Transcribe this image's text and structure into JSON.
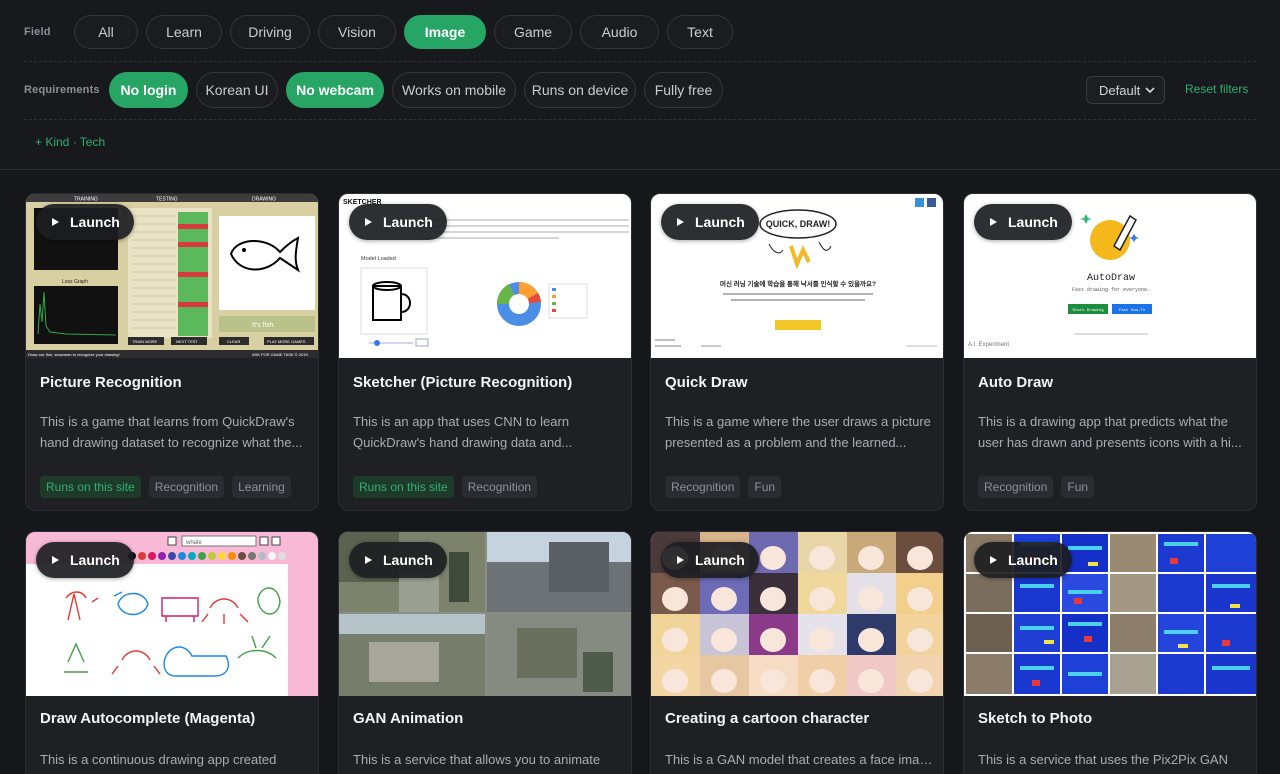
{
  "filters": {
    "field_label": "Field",
    "field_chips": [
      {
        "label": "All",
        "active": false
      },
      {
        "label": "Learn",
        "active": false
      },
      {
        "label": "Driving",
        "active": false
      },
      {
        "label": "Vision",
        "active": false
      },
      {
        "label": "Image",
        "active": true
      },
      {
        "label": "Game",
        "active": false
      },
      {
        "label": "Audio",
        "active": false
      },
      {
        "label": "Text",
        "active": false
      }
    ],
    "requirements_label": "Requirements",
    "requirement_chips": [
      {
        "label": "No login",
        "active": true
      },
      {
        "label": "Korean UI",
        "active": false
      },
      {
        "label": "No webcam",
        "active": true
      },
      {
        "label": "Works on mobile",
        "active": false
      },
      {
        "label": "Runs on device",
        "active": false
      },
      {
        "label": "Fully free",
        "active": false
      }
    ],
    "sort_value": "Default",
    "reset_label": "Reset filters",
    "kind_tech_label": "+ Kind · Tech"
  },
  "launch_label": "Launch",
  "cards": [
    {
      "title": "Picture Recognition",
      "desc_line1": "This is a game that learns from QuickDraw's",
      "desc_line2": "hand drawing dataset to recognize what the...",
      "tags": [
        "Runs on this site",
        "Recognition",
        "Learning"
      ],
      "thumb": {
        "headers": [
          "TRAINING",
          "TESTING",
          "DRAWING"
        ],
        "guess": "It's fish.",
        "buttons": [
          "TRAIN MORE",
          "NEXT TEST",
          "CLEAR",
          "PLAY MORE GAMES"
        ],
        "footer_left": "Draw car, fish, snowman to recognize your drawing!",
        "footer_right": "ASK FOR GAME TASK © 2019",
        "loss_label": "Loss Graph"
      }
    },
    {
      "title": "Sketcher (Picture Recognition)",
      "desc_line1": "This is an app that uses CNN to learn",
      "desc_line2": "QuickDraw's hand drawing data and...",
      "tags": [
        "Runs on this site",
        "Recognition"
      ],
      "thumb": {
        "logo": "SKETCHER",
        "model_label": "Model Loaded"
      }
    },
    {
      "title": "Quick Draw",
      "desc_line1": "This is a game where the user draws a picture",
      "desc_line2": "presented as a problem and the learned...",
      "tags": [
        "Recognition",
        "Fun"
      ],
      "thumb": {
        "logo": "QUICK, DRAW!",
        "headline": "머신 러닝 기술에 학습을 통해 낙서를 인식할 수 있을까요?"
      }
    },
    {
      "title": "Auto Draw",
      "desc_line1": "This is a drawing app that predicts what the",
      "desc_line2": "user has drawn and presents icons with a hi...",
      "tags": [
        "Recognition",
        "Fun"
      ],
      "thumb": {
        "logo": "AutoDraw",
        "subtitle": "Fast drawing for everyone.",
        "btn1": "Start Drawing",
        "btn2": "Fast How-To",
        "footer": "A.I. Experiment"
      }
    },
    {
      "title": "Draw Autocomplete (Magenta)",
      "desc_line1": "This is a continuous drawing app created",
      "desc_line2": "",
      "tags": [],
      "thumb": {
        "query": "whale"
      }
    },
    {
      "title": "GAN Animation",
      "desc_line1": "This is a service that allows you to animate",
      "desc_line2": "",
      "tags": [],
      "thumb": {}
    },
    {
      "title": "Creating a cartoon character",
      "desc_line1": "This is a GAN model that creates a face image",
      "desc_line2": "",
      "tags": [],
      "thumb": {}
    },
    {
      "title": "Sketch to Photo",
      "desc_line1": "This is a service that uses the Pix2Pix GAN",
      "desc_line2": "",
      "tags": [],
      "thumb": {}
    }
  ],
  "colors": {
    "accent": "#27a565",
    "background": "#16171b",
    "card": "#1f2024"
  },
  "icons": [
    "play-icon",
    "chevron-down-icon"
  ]
}
